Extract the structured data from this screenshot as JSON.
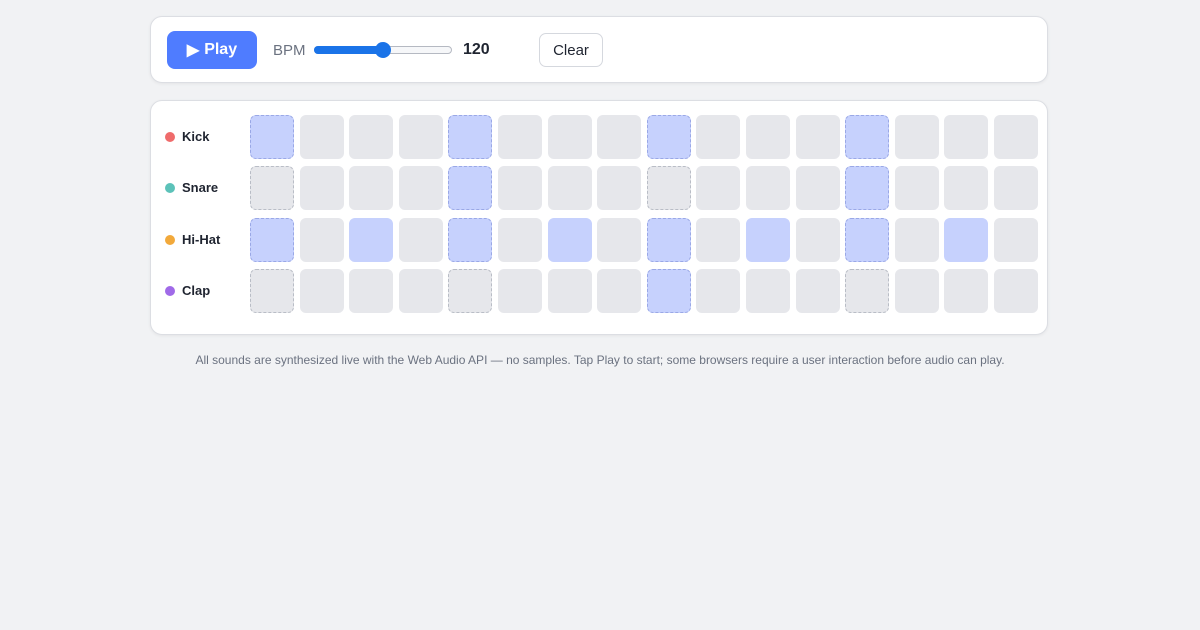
{
  "toolbar": {
    "play_icon": "▶",
    "play_label": "Play",
    "bpm_label": "BPM",
    "bpm_value": "120",
    "bpm_slider_level": 0.44,
    "clear_label": "Clear"
  },
  "grid": {
    "steps": 16,
    "tracks": [
      {
        "name": "Kick",
        "color": "#ef6b6b",
        "steps": [
          1,
          0,
          0,
          0,
          1,
          0,
          0,
          0,
          1,
          0,
          0,
          0,
          1,
          0,
          0,
          0
        ]
      },
      {
        "name": "Snare",
        "color": "#5cc2b9",
        "steps": [
          0,
          0,
          0,
          0,
          1,
          0,
          0,
          0,
          0,
          0,
          0,
          0,
          1,
          0,
          0,
          0
        ]
      },
      {
        "name": "Hi-Hat",
        "color": "#f2a93b",
        "steps": [
          1,
          0,
          1,
          0,
          1,
          0,
          1,
          0,
          1,
          0,
          1,
          0,
          1,
          0,
          1,
          0
        ]
      },
      {
        "name": "Clap",
        "color": "#a06ae8",
        "steps": [
          0,
          0,
          0,
          0,
          0,
          0,
          0,
          0,
          1,
          0,
          0,
          0,
          0,
          0,
          0,
          0
        ]
      }
    ]
  },
  "footnote": "All sounds are synthesized live with the Web Audio API — no samples. Tap Play to start; some browsers require a user interaction before audio can play."
}
